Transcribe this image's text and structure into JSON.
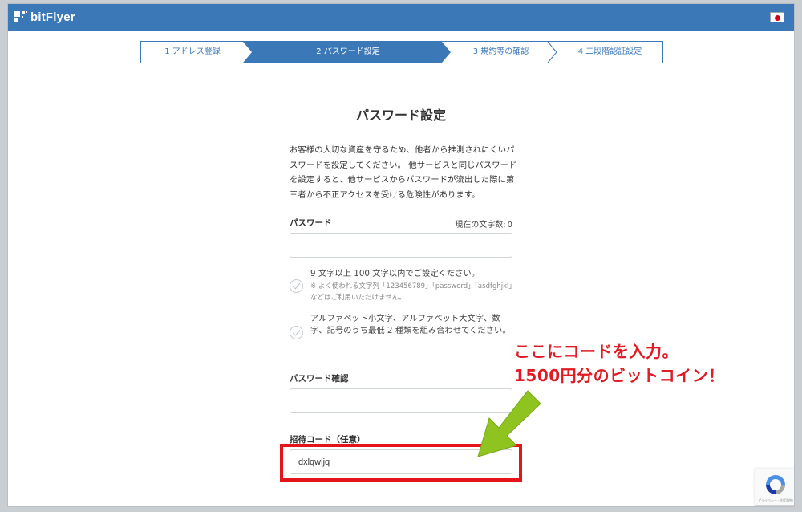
{
  "header": {
    "brand": "bitFlyer",
    "brand_color": "#3a78b8",
    "language_flag": "japan-flag-icon"
  },
  "steps": [
    {
      "label": "1 アドレス登録",
      "active": false
    },
    {
      "label": "2 パスワード設定",
      "active": true
    },
    {
      "label": "3 規約等の確認",
      "active": false
    },
    {
      "label": "4 二段階認証設定",
      "active": false
    }
  ],
  "page": {
    "title": "パスワード設定",
    "intro": "お客様の大切な資産を守るため、他者から推測されにくいパスワードを設定してください。 他サービスと同じパスワードを設定すると、他サービスからパスワードが流出した際に第三者から不正アクセスを受ける危険性があります。"
  },
  "password": {
    "label": "パスワード",
    "counter_label": "現在の文字数:",
    "counter_value": "0",
    "value": ""
  },
  "rules": [
    {
      "text": "9 文字以上 100 文字以内でご設定ください。",
      "note": "※ よく使われる文字列「123456789」「password」「asdfghjkl」などはご利用いただけません。"
    },
    {
      "text": "アルファベット小文字、アルファベット大文字、数字、記号のうち最低 2 種類を組み合わせてください。",
      "note": ""
    }
  ],
  "password_confirm": {
    "label": "パスワード確認",
    "value": ""
  },
  "invite_code": {
    "label": "招待コード（任意）",
    "value": "dxlqwljq"
  },
  "annotation": {
    "line1": "ここにコードを入力。",
    "line2": "1500円分のビットコイン！",
    "text_color": "#e01b24",
    "arrow_color": "#8fc31f"
  },
  "recaptcha": {
    "note": "プライバシー・利用規約"
  }
}
